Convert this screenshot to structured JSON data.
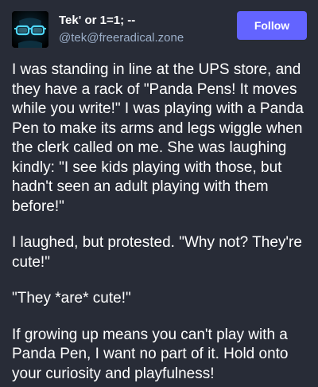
{
  "account": {
    "display_name": "Tek' or 1=1; --",
    "handle": "@tek@freeradical.zone",
    "avatar_icon": "cyan-glowing-glasses-avatar"
  },
  "actions": {
    "follow_label": "Follow"
  },
  "post": {
    "paragraphs": [
      "I was standing in line at the UPS store, and they have a rack of \"Panda Pens! It moves while you write!\" I was playing with a Panda Pen to make its arms and legs wiggle when the clerk called on me. She was laughing kindly: \"I see kids playing with those, but hadn't seen an adult playing with them before!\"",
      "I laughed, but protested. \"Why not? They're cute!\"",
      "\"They *are* cute!\"",
      "If growing up means you can't play with a Panda Pen, I want no part of it. Hold onto your curiosity and playfulness!"
    ]
  },
  "colors": {
    "background": "#282c37",
    "accent": "#6364ff",
    "secondary_text": "#9baec8",
    "avatar_glow": "#4fd8ff"
  }
}
